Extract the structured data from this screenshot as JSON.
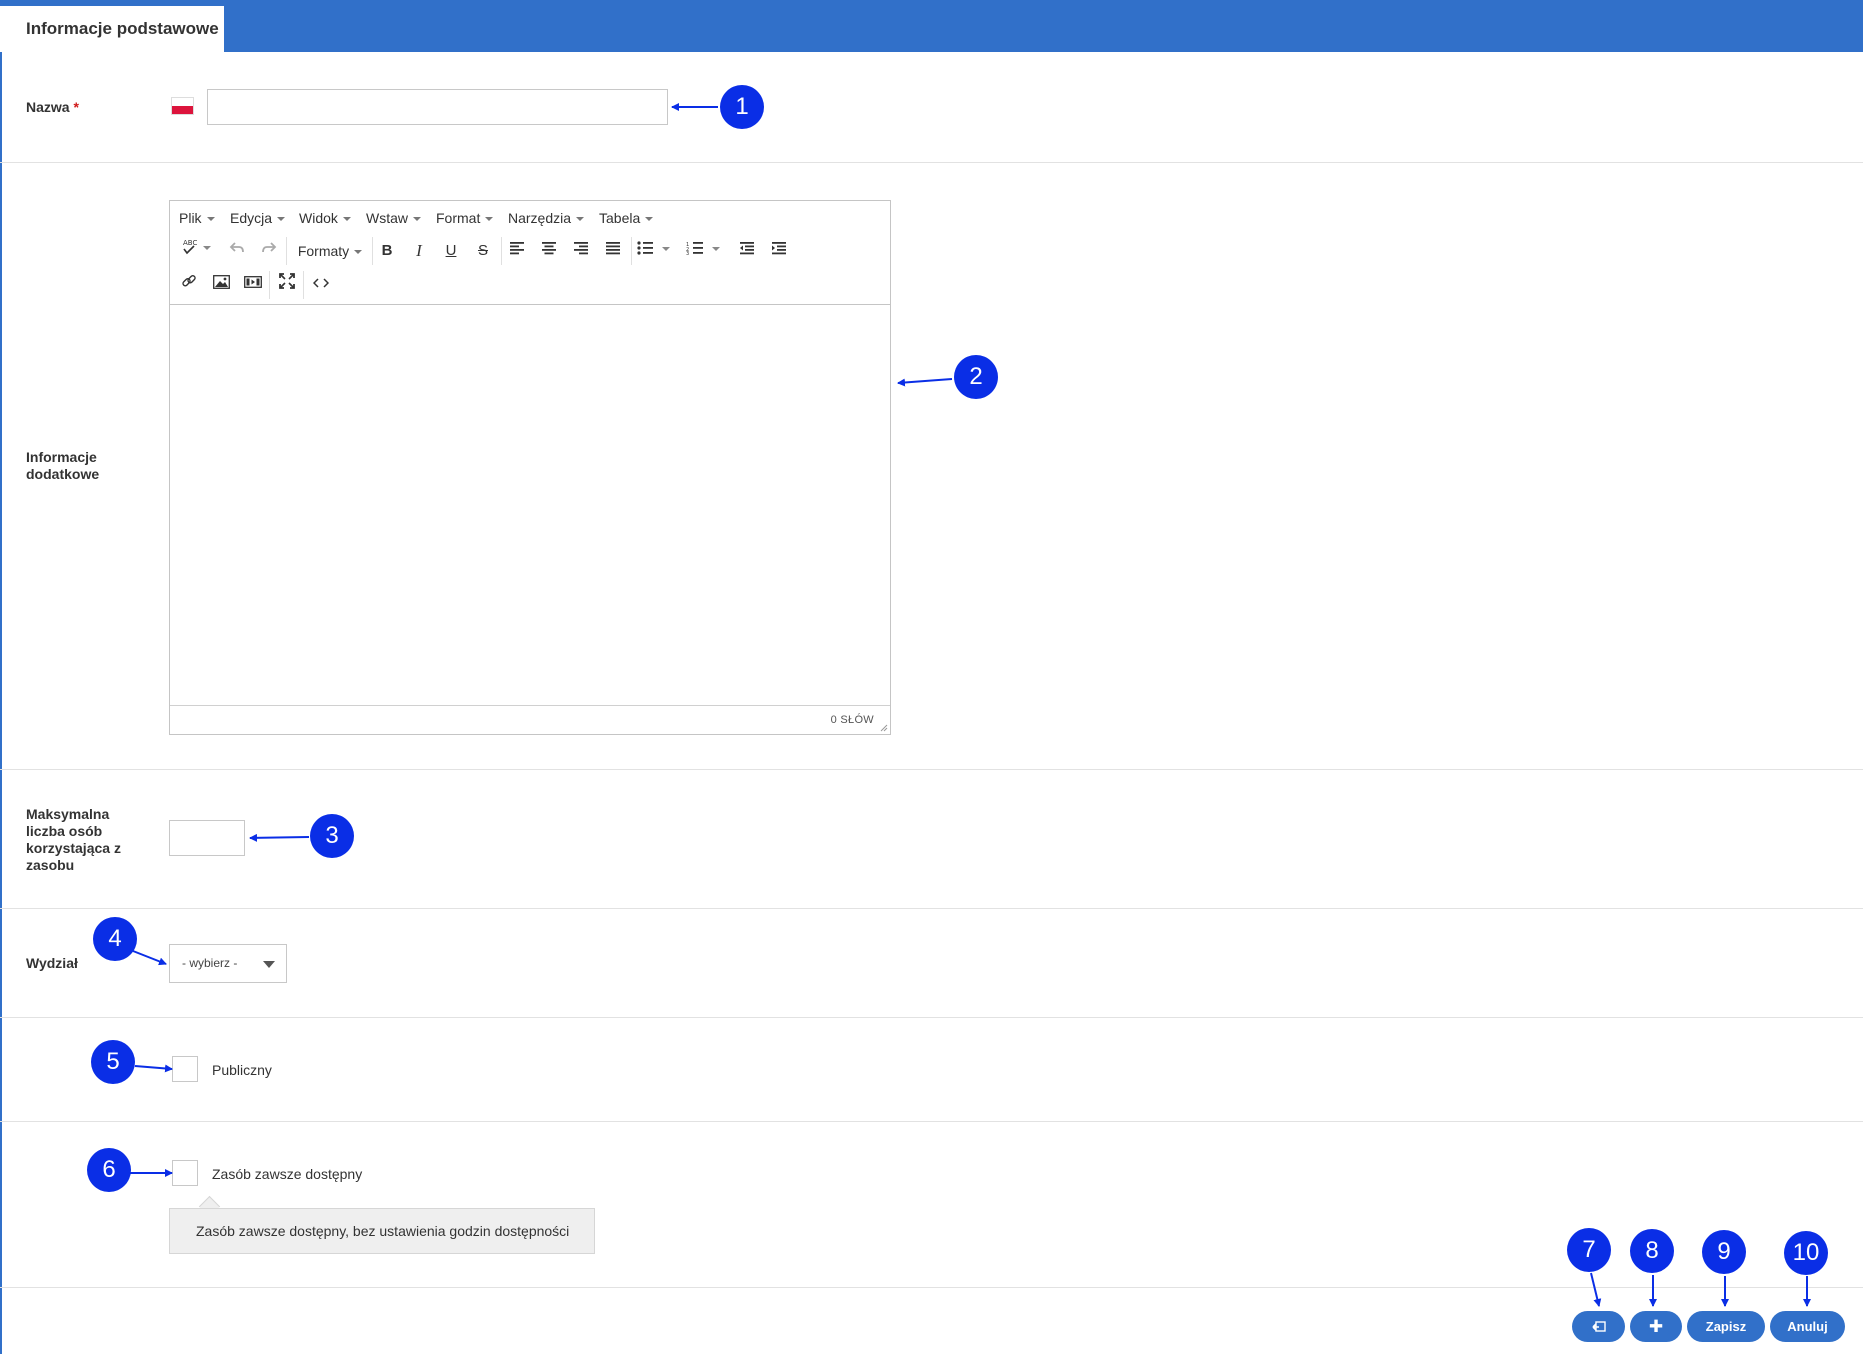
{
  "tab": {
    "label": "Informacje podstawowe"
  },
  "form": {
    "nazwa": {
      "label": "Nazwa",
      "required_mark": "*",
      "value": ""
    },
    "info": {
      "label_line1": "Informacje",
      "label_line2": "dodatkowe"
    },
    "max": {
      "label_lines": [
        "Maksymalna",
        "liczba osób",
        "korzystająca z",
        "zasobu"
      ],
      "value": ""
    },
    "wydzial": {
      "label": "Wydział",
      "selected": "- wybierz -"
    },
    "publiczny": {
      "label": "Publiczny",
      "checked": false
    },
    "zawsze": {
      "label": "Zasób zawsze dostępny",
      "checked": false,
      "tooltip": "Zasób zawsze dostępny, bez ustawienia godzin dostępności"
    }
  },
  "editor": {
    "menu": [
      "Plik",
      "Edycja",
      "Widok",
      "Wstaw",
      "Format",
      "Narzędzia",
      "Tabela"
    ],
    "formats_label": "Formaty",
    "word_count": "0 SŁÓW"
  },
  "buttons": {
    "save": "Zapisz",
    "cancel": "Anuluj",
    "add_glyph": "✚"
  },
  "callouts": [
    "1",
    "2",
    "3",
    "4",
    "5",
    "6",
    "7",
    "8",
    "9",
    "10"
  ],
  "colors": {
    "accent": "#3170c9",
    "callout": "#0a2ee6",
    "required": "#d01a1a"
  }
}
